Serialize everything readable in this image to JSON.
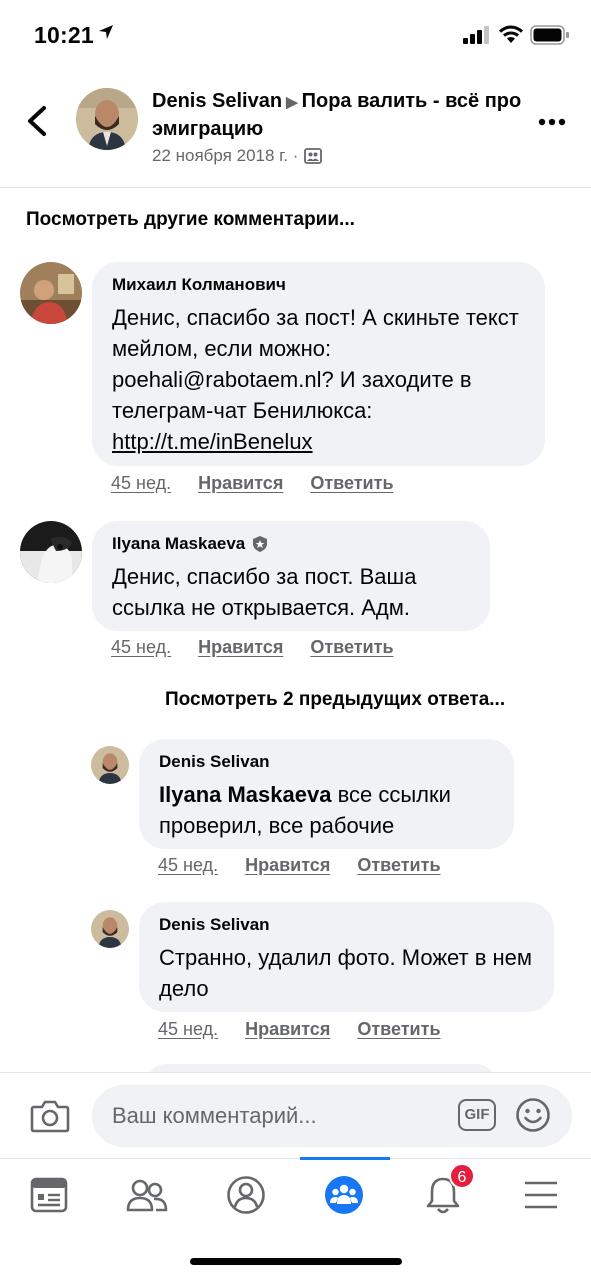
{
  "status_bar": {
    "time": "10:21"
  },
  "header": {
    "author": "Denis Selivan",
    "group": "Пора валить - всё про эмиграцию",
    "date": "22 ноября 2018 г. ·"
  },
  "view_more_comments": "Посмотреть другие комментарии...",
  "comments": [
    {
      "name": "Михаил Колманович",
      "text": "Денис, спасибо за пост! А скиньте текст мейлом, если можно: poehali@rabotaem.nl? И заходите в телеграм-чат Бенилюкса: ",
      "link": "http://t.me/inBenelux",
      "time": "45 нед.",
      "like": "Нравится",
      "reply": "Ответить"
    },
    {
      "name": "Ilyana Maskaeva",
      "text": "Денис, спасибо за пост. Ваша ссылка не открывается. Адм.",
      "time": "45 нед.",
      "like": "Нравится",
      "reply": "Ответить"
    }
  ],
  "view_previous_replies": "Посмотреть 2 предыдущих ответа...",
  "replies": [
    {
      "name": "Denis Selivan",
      "mention": "Ilyana Maskaeva",
      "text": " все ссылки проверил, все рабочие",
      "time": "45 нед.",
      "like": "Нравится",
      "reply": "Ответить"
    },
    {
      "name": "Denis Selivan",
      "text": "Странно, удалил фото. Может в нем дело",
      "time": "45 нед.",
      "like": "Нравится",
      "reply": "Ответить"
    }
  ],
  "composer": {
    "placeholder": "Ваш комментарий...",
    "gif_label": "GIF"
  },
  "tabbar": {
    "items": [
      "news-feed",
      "friends",
      "profile",
      "groups",
      "notifications",
      "menu"
    ],
    "active": "groups",
    "notification_count": "6"
  },
  "colors": {
    "accent": "#1877f2",
    "badge": "#e41e3f",
    "bubble": "#f0f2f5",
    "muted": "#65676b"
  }
}
